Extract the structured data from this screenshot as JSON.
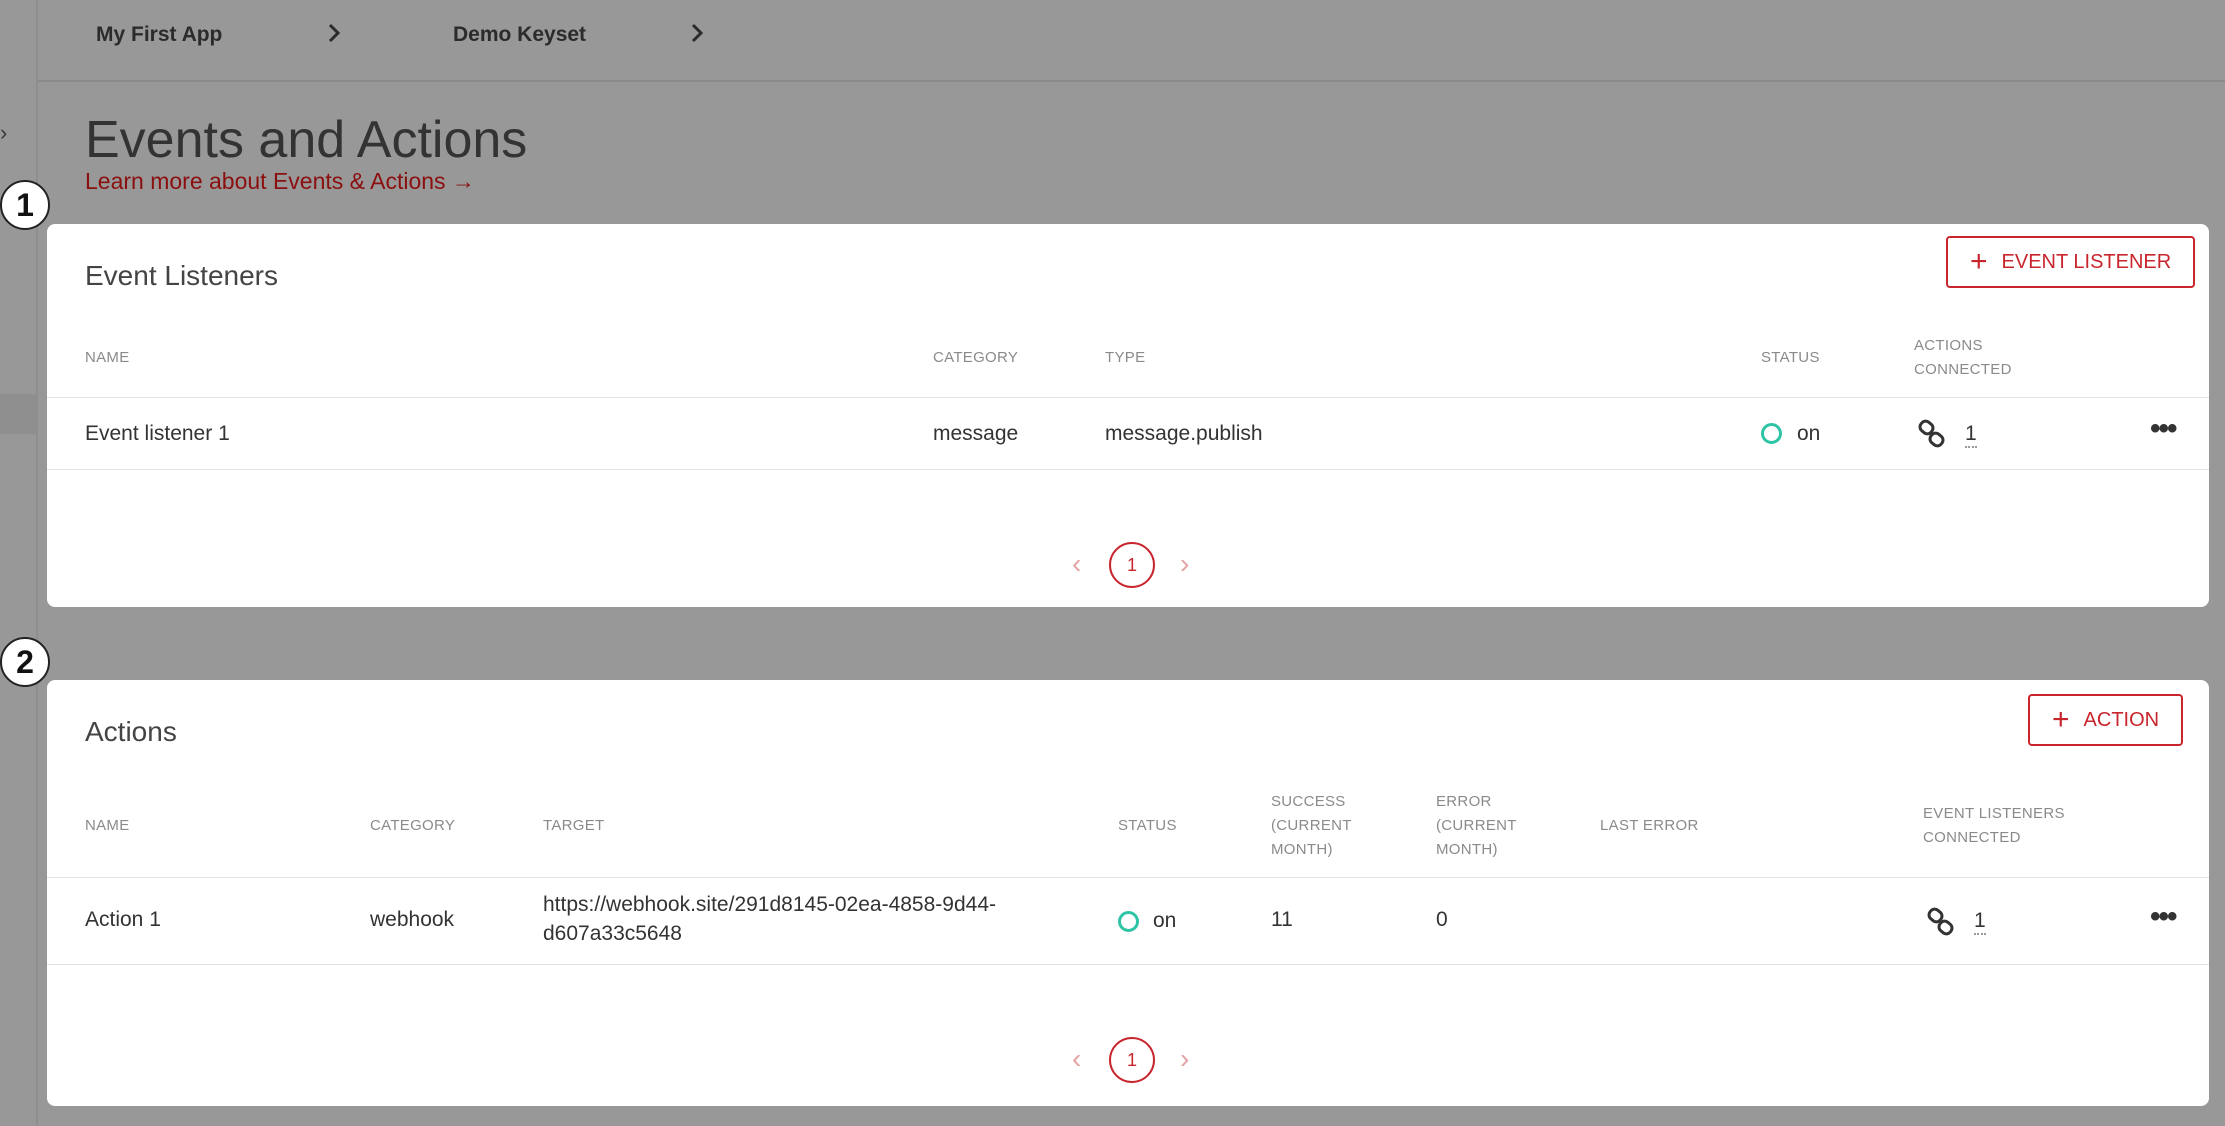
{
  "breadcrumb": {
    "app": "My First App",
    "keyset": "Demo Keyset"
  },
  "page": {
    "title": "Events and Actions",
    "learn_more": "Learn more about Events & Actions →"
  },
  "steps": [
    "1",
    "2"
  ],
  "event_listeners": {
    "title": "Event Listeners",
    "add_button": "EVENT LISTENER",
    "columns": {
      "name": "NAME",
      "category": "CATEGORY",
      "type": "TYPE",
      "status": "STATUS",
      "actions_connected_1": "ACTIONS",
      "actions_connected_2": "CONNECTED"
    },
    "rows": [
      {
        "name": "Event listener 1",
        "category": "message",
        "type": "message.publish",
        "status": "on",
        "actions_connected": "1"
      }
    ],
    "pagination": {
      "current": "1",
      "prev": "‹",
      "next": "›"
    }
  },
  "actions": {
    "title": "Actions",
    "add_button": "ACTION",
    "columns": {
      "name": "NAME",
      "category": "CATEGORY",
      "target": "TARGET",
      "status": "STATUS",
      "success_1": "SUCCESS",
      "success_2": "(CURRENT",
      "success_3": "MONTH)",
      "error_1": "ERROR",
      "error_2": "(CURRENT",
      "error_3": "MONTH)",
      "last_error": "LAST ERROR",
      "event_listeners_connected_1": "EVENT LISTENERS",
      "event_listeners_connected_2": "CONNECTED"
    },
    "rows": [
      {
        "name": "Action 1",
        "category": "webhook",
        "target_line1": "https://webhook.site/291d8145-02ea-4858-9d44-",
        "target_line2": "d607a33c5648",
        "status": "on",
        "success": "11",
        "error": "0",
        "last_error": "",
        "event_listeners_connected": "1"
      }
    ],
    "pagination": {
      "current": "1",
      "prev": "‹",
      "next": "›"
    }
  },
  "colors": {
    "accent": "#c9252d",
    "status_on": "#2ec4a6",
    "overlay": "#989898"
  },
  "icons": {
    "breadcrumb_separator": "chevron-right-icon",
    "add": "plus-icon",
    "connected": "link-icon",
    "row_menu": "more-horizontal-icon"
  }
}
